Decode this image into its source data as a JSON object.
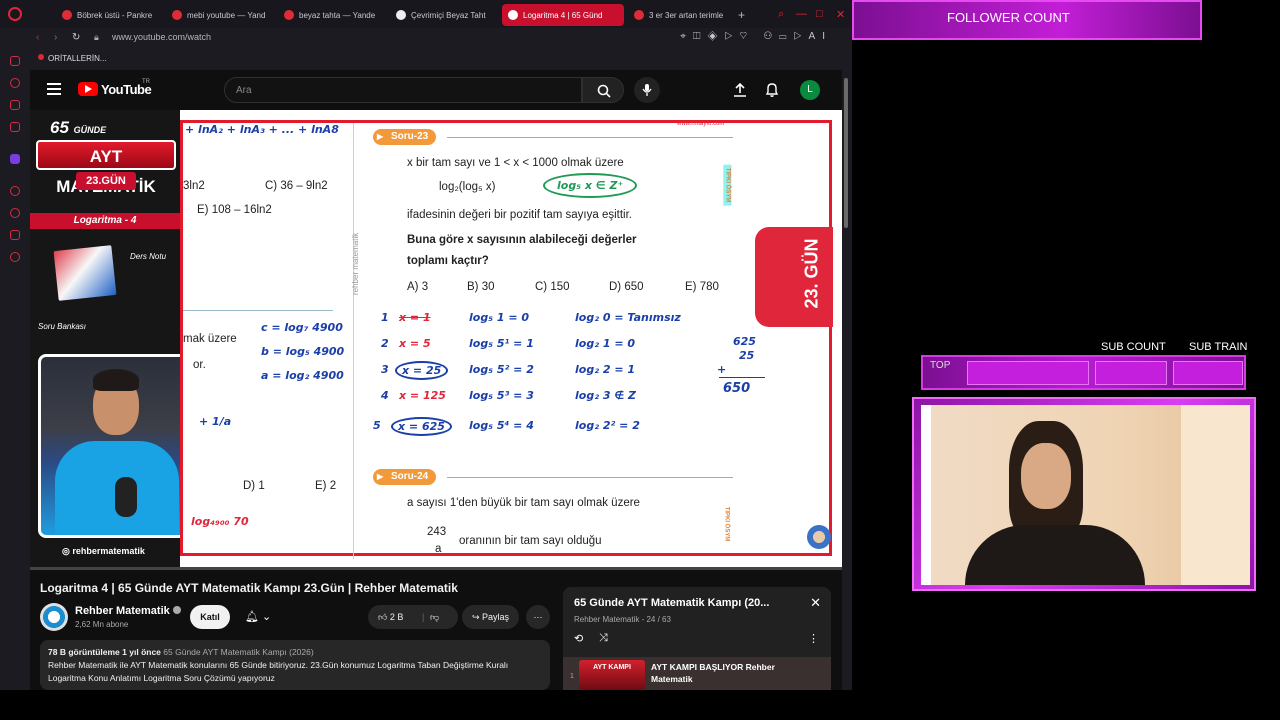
{
  "browser": {
    "tabs": [
      {
        "label": "Böbrek üstü - Pankre"
      },
      {
        "label": "mebi youtube — Yand"
      },
      {
        "label": "beyaz tahta — Yande"
      },
      {
        "label": "Çevrimiçi Beyaz Taht"
      },
      {
        "label": "Logaritma 4 | 65 Günd",
        "active": true
      },
      {
        "label": "3 er 3er artan terimle"
      }
    ],
    "add_tab": "+",
    "url": "www.youtube.com/watch",
    "bookmark": "ORİTALLERİN..."
  },
  "youtube": {
    "logo_text": "YouTube",
    "country": "TR",
    "search_placeholder": "Ara",
    "avatar_letter": "L"
  },
  "video": {
    "overlay": {
      "badge_days": "65",
      "badge_days_suffix": "GÜNDE",
      "badge_title": "AYT MATEMATİK",
      "badge_day": "23.GÜN",
      "topic": "Logaritma - 4",
      "note_ders": "Ders Notu",
      "note_soru": "Soru Bankası",
      "instagram": "rehbermatematik",
      "site": "www.rmtayfo.com",
      "side_label": "rehber matematik",
      "day_badge": "23. GÜN",
      "tipki": "TIPKI ÖSYM"
    },
    "board": {
      "left_lines": [
        "+ lnA₂ + lnA₃ + ... + lnA8",
        "3ln2",
        "C) 36 – 9ln2",
        "E) 108 – 16ln2",
        "mak üzere",
        "or.",
        "D) 1",
        "E) 2"
      ],
      "left_hand": [
        "c = log₇ 4900",
        "b = log₅ 4900",
        "a = log₂ 4900",
        "+ 1/a",
        "log₄₉₀₀ 70"
      ],
      "soru23": {
        "header": "Soru-23",
        "line1": "x bir tam sayı ve 1 < x < 1000 olmak üzere",
        "expr": "log₂(log₅ x)",
        "line2": "ifadesinin değeri bir pozitif tam sayıya eşittir.",
        "question1": "Buna göre x sayısının alabileceği değerler",
        "question2": "toplamı kaçtır?",
        "options": [
          "A) 3",
          "B) 30",
          "C) 150",
          "D) 650",
          "E) 780"
        ],
        "hand_note": "log₅ x ∈ Z⁺"
      },
      "solution_rows": [
        {
          "n": "1",
          "x": "x = 1",
          "a": "log₅ 1 = 0",
          "b": "log₂ 0 = Tanımsız"
        },
        {
          "n": "2",
          "x": "x = 5",
          "a": "log₅ 5¹ = 1",
          "b": "log₂ 1 = 0"
        },
        {
          "n": "3",
          "x": "x = 25",
          "a": "log₅ 5² = 2",
          "b": "log₂ 2 = 1"
        },
        {
          "n": "4",
          "x": "x = 125",
          "a": "log₅ 5³ = 3",
          "b": "log₂ 3 ∉ Z"
        },
        {
          "n": "5",
          "x": "x = 625",
          "a": "log₅ 5⁴ = 4",
          "b": "log₂ 2² = 2"
        }
      ],
      "sum": [
        "625",
        "25",
        "+",
        "650"
      ],
      "soru24": {
        "header": "Soru-24",
        "line1": "a sayısı 1'den büyük bir tam sayı olmak üzere",
        "frac_num": "243",
        "frac_den": "a",
        "line2": "oranının bir tam sayı olduğu"
      }
    },
    "title": "Logaritma 4 | 65 Günde AYT Matematik Kampı 23.Gün | Rehber Matematik",
    "channel": "Rehber Matematik",
    "subscribers": "2,62 Mn abone",
    "join": "Katıl",
    "likes": "2 B",
    "share": "Paylaş",
    "description": {
      "views": "78 B görüntüleme",
      "age": "1 yıl önce",
      "playlist": "65 Günde AYT Matematik Kampı (2026)",
      "text": "Rehber Matematik ile AYT Matematik konularını 65 Günde bitiriyoruz. 23.Gün konumuz Logaritma Taban Değiştirme Kuralı Logaritma Konu Anlatımı Logaritma Soru Çözümü yapıyoruz"
    }
  },
  "playlist": {
    "title": "65 Günde AYT Matematik Kampı (20...",
    "channel": "Rehber Matematik",
    "position": "24 / 63",
    "item_index": "1",
    "item_thumb": "AYT KAMPI",
    "item_title": "AYT KAMPI BAŞLIYOR Rehber Matematik"
  },
  "stream": {
    "follower_label": "FOLLOWER COUNT",
    "sub_count_label": "SUB COUNT",
    "sub_train_label": "SUB TRAIN",
    "top_label": "TOP"
  }
}
